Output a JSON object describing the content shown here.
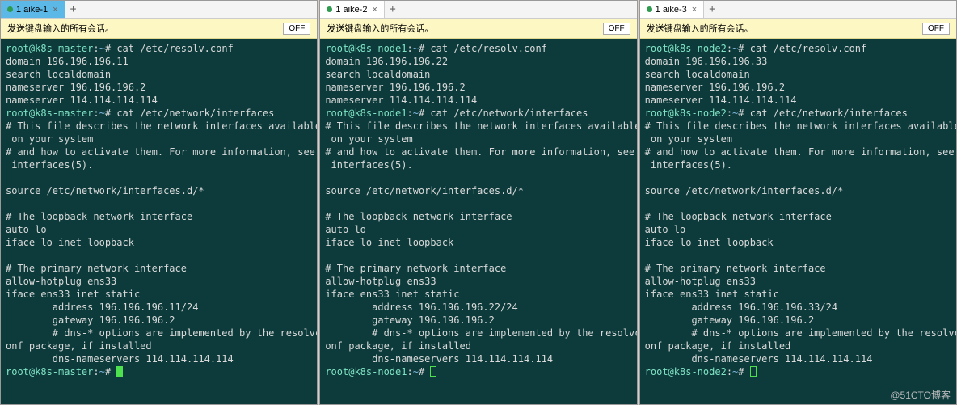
{
  "watermark": "@51CTO博客",
  "panes": [
    {
      "id": "p1",
      "tab": "1 aike-1",
      "tab_active": true,
      "notice": "发送键盘输入的所有会话。",
      "off": "OFF",
      "prompt_host": "root@k8s-master",
      "prompt_path": "~",
      "prompt_sym": "#",
      "cmd1": "cat /etc/resolv.conf",
      "resolv": "domain 196.196.196.11\nsearch localdomain\nnameserver 196.196.196.2\nnameserver 114.114.114.114",
      "cmd2": "cat /etc/network/interfaces",
      "ifaces": "# This file describes the network interfaces available\n on your system\n# and how to activate them. For more information, see\n interfaces(5).\n\nsource /etc/network/interfaces.d/*\n\n# The loopback network interface\nauto lo\niface lo inet loopback\n\n# The primary network interface\nallow-hotplug ens33\niface ens33 inet static\n        address 196.196.196.11/24\n        gateway 196.196.196.2\n        # dns-* options are implemented by the resolvc\nonf package, if installed\n        dns-nameservers 114.114.114.114",
      "cursor": "solid"
    },
    {
      "id": "p2",
      "tab": "1 aike-2",
      "tab_active": false,
      "notice": "发送键盘输入的所有会话。",
      "off": "OFF",
      "prompt_host": "root@k8s-node1",
      "prompt_path": "~",
      "prompt_sym": "#",
      "cmd1": "cat /etc/resolv.conf",
      "resolv": "domain 196.196.196.22\nsearch localdomain\nnameserver 196.196.196.2\nnameserver 114.114.114.114",
      "cmd2": "cat /etc/network/interfaces",
      "ifaces": "# This file describes the network interfaces available\n on your system\n# and how to activate them. For more information, see\n interfaces(5).\n\nsource /etc/network/interfaces.d/*\n\n# The loopback network interface\nauto lo\niface lo inet loopback\n\n# The primary network interface\nallow-hotplug ens33\niface ens33 inet static\n        address 196.196.196.22/24\n        gateway 196.196.196.2\n        # dns-* options are implemented by the resolvc\nonf package, if installed\n        dns-nameservers 114.114.114.114",
      "cursor": "outline"
    },
    {
      "id": "p3",
      "tab": "1 aike-3",
      "tab_active": false,
      "notice": "发送键盘输入的所有会话。",
      "off": "OFF",
      "prompt_host": "root@k8s-node2",
      "prompt_path": "~",
      "prompt_sym": "#",
      "cmd1": "cat /etc/resolv.conf",
      "resolv": "domain 196.196.196.33\nsearch localdomain\nnameserver 196.196.196.2\nnameserver 114.114.114.114",
      "cmd2": "cat /etc/network/interfaces",
      "ifaces": "# This file describes the network interfaces available\n on your system\n# and how to activate them. For more information, see\n interfaces(5).\n\nsource /etc/network/interfaces.d/*\n\n# The loopback network interface\nauto lo\niface lo inet loopback\n\n# The primary network interface\nallow-hotplug ens33\niface ens33 inet static\n        address 196.196.196.33/24\n        gateway 196.196.196.2\n        # dns-* options are implemented by the resolvc\nonf package, if installed\n        dns-nameservers 114.114.114.114",
      "cursor": "outline"
    }
  ]
}
